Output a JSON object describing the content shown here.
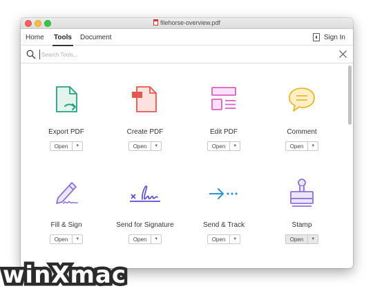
{
  "window": {
    "title": "filehorse-overview.pdf"
  },
  "menu": {
    "tabs": [
      {
        "label": "Home"
      },
      {
        "label": "Tools"
      },
      {
        "label": "Document"
      }
    ],
    "sign_in": "Sign In"
  },
  "search": {
    "placeholder": "Search Tools..."
  },
  "tools": [
    {
      "label": "Export PDF",
      "open": "Open",
      "icon": "export-pdf-icon",
      "color": "#26a17e"
    },
    {
      "label": "Create PDF",
      "open": "Open",
      "icon": "create-pdf-icon",
      "color": "#e5564d"
    },
    {
      "label": "Edit PDF",
      "open": "Open",
      "icon": "edit-pdf-icon",
      "color": "#d960c4"
    },
    {
      "label": "Comment",
      "open": "Open",
      "icon": "comment-icon",
      "color": "#f0b62a"
    },
    {
      "label": "Fill & Sign",
      "open": "Open",
      "icon": "fill-sign-icon",
      "color": "#8e71d8"
    },
    {
      "label": "Send for Signature",
      "open": "Open",
      "icon": "send-signature-icon",
      "color": "#5a4dd2"
    },
    {
      "label": "Send & Track",
      "open": "Open",
      "icon": "send-track-icon",
      "color": "#2f93d0"
    },
    {
      "label": "Stamp",
      "open": "Open",
      "icon": "stamp-icon",
      "color": "#8e71d8"
    }
  ],
  "watermark": "winXmac"
}
